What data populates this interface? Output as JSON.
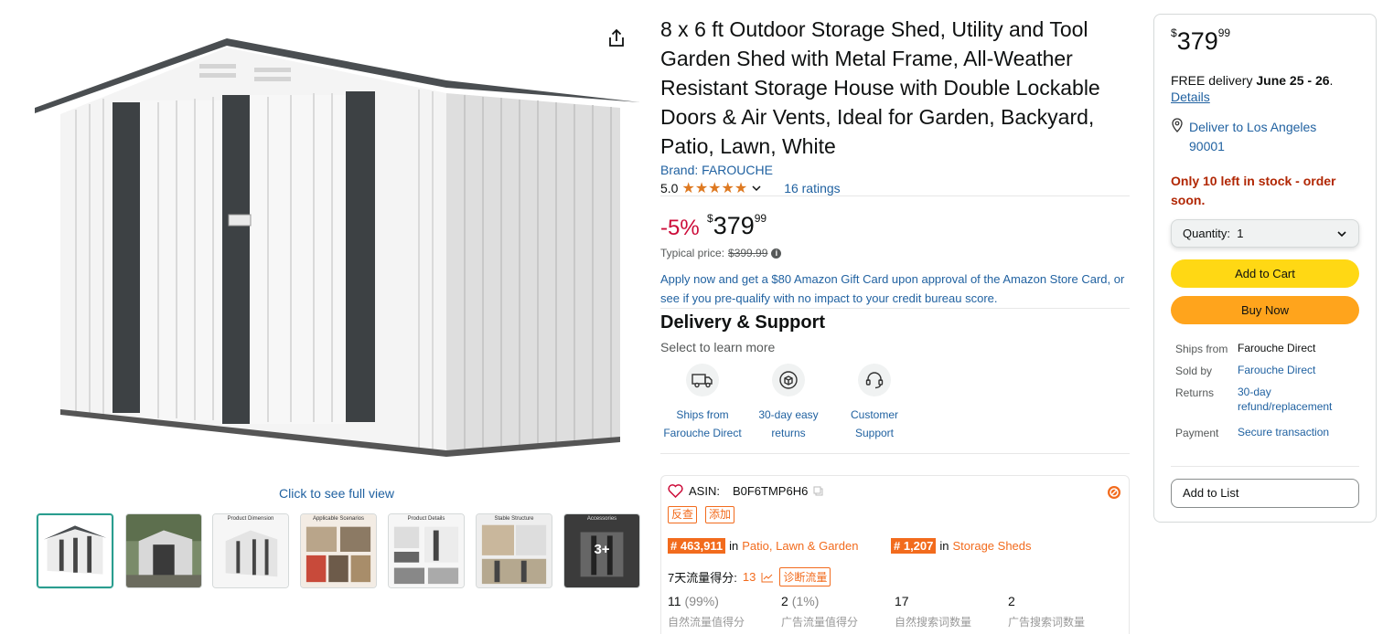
{
  "product": {
    "title": "8 x 6 ft Outdoor Storage Shed, Utility and Tool Garden Shed with Metal Frame, All-Weather Resistant Storage House with Double Lockable Doors & Air Vents, Ideal for Garden, Backyard, Patio, Lawn, White",
    "brand": "Brand: FAROUCHE",
    "rating_value": "5.0",
    "stars": "★★★★★",
    "ratings_count": "16 ratings",
    "discount": "-5%",
    "price_currency": "$",
    "price_whole": "379",
    "price_fraction": "99",
    "typical_label": "Typical price:",
    "typical_price": "$399.99",
    "apply_offer": "Apply now and get a $80 Amazon Gift Card upon approval of the Amazon Store Card, or see if you pre-qualify with no impact to your credit bureau score."
  },
  "gallery": {
    "full_view": "Click to see full view",
    "more_label": "3+",
    "thumb_captions": [
      "",
      "",
      "Product Dimension",
      "Applicable Scenarios",
      "Product Details",
      "Stable Structure",
      "Accessories"
    ]
  },
  "delivery_support": {
    "heading": "Delivery & Support",
    "subheading": "Select to learn more",
    "items": [
      {
        "label": "Ships from Farouche Direct",
        "icon": "truck-icon"
      },
      {
        "label": "30-day easy returns",
        "icon": "returns-box-icon"
      },
      {
        "label": "Customer Support",
        "icon": "headset-icon"
      }
    ]
  },
  "plugin": {
    "asin_label": "ASIN:",
    "asin": "B0F6TMP6H6",
    "tag_check": "反查",
    "tag_add": "添加",
    "rank1_num": "# 463,911",
    "rank1_in": "in",
    "rank1_cat": "Patio, Lawn & Garden",
    "rank2_num": "# 1,207",
    "rank2_in": "in",
    "rank2_cat": "Storage Sheds",
    "traffic_label": "7天流量得分:",
    "traffic_value": "13",
    "diagnose": "诊断流量",
    "stats": [
      {
        "value": "11",
        "pct": "(99%)",
        "label": "自然流量值得分"
      },
      {
        "value": "2",
        "pct": "(1%)",
        "label": "广告流量值得分"
      },
      {
        "value": "17",
        "pct": "",
        "label": "自然搜索词数量"
      },
      {
        "value": "2",
        "pct": "",
        "label": "广告搜索词数量"
      }
    ]
  },
  "buybox": {
    "price_currency": "$",
    "price_whole": "379",
    "price_fraction": "99",
    "free_delivery_prefix": "FREE delivery ",
    "delivery_dates": "June 25 - 26",
    "delivery_suffix": ".",
    "details": "Details",
    "deliver_to": "Deliver to Los Angeles 90001",
    "stock": "Only 10 left in stock - order soon.",
    "quantity_label": "Quantity:",
    "quantity_value": "1",
    "add_to_cart": "Add to Cart",
    "buy_now": "Buy Now",
    "ships_from_label": "Ships from",
    "ships_from": "Farouche Direct",
    "sold_by_label": "Sold by",
    "sold_by": "Farouche Direct",
    "returns_label": "Returns",
    "returns": "30-day refund/replacement",
    "payment_label": "Payment",
    "payment": "Secure transaction",
    "add_to_list": "Add to List"
  },
  "colors": {
    "link": "#2162a1",
    "deal": "#cc0c39",
    "star": "#de7921",
    "cart": "#ffd814",
    "buy": "#ffa41c",
    "plugin_accent": "#f26b1d"
  }
}
